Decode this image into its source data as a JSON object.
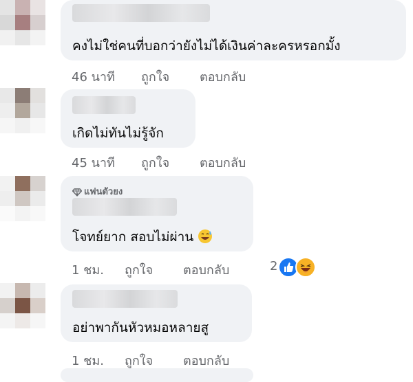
{
  "comments": [
    {
      "text": "คงไม่ใช่คนที่บอกว่ายังไม่ได้เงินค่าละครหรอกมั้ง",
      "time": "46 นาที",
      "like_label": "ถูกใจ",
      "reply_label": "ตอบกลับ"
    },
    {
      "text": "เกิดไม่ทันไม่รู้จัก",
      "time": "45 นาที",
      "like_label": "ถูกใจ",
      "reply_label": "ตอบกลับ"
    },
    {
      "badge": "แฟนตัวยง",
      "text": "โจทย์ยาก สอบไม่ผ่าน",
      "time": "1 ชม.",
      "like_label": "ถูกใจ",
      "reply_label": "ตอบกลับ",
      "reaction_count": "2",
      "reactions": [
        "like-icon",
        "haha-icon"
      ]
    },
    {
      "text": "อย่าพากันหัวหมอหลายสู",
      "time": "1 ชม.",
      "like_label": "ถูกใจ",
      "reply_label": "ตอบกลับ"
    }
  ],
  "colors": {
    "bubble": "#f0f2f5",
    "text": "#050505",
    "meta": "#65676b",
    "like_blue": "#1877f2",
    "haha_yellow": "#f7b125"
  }
}
